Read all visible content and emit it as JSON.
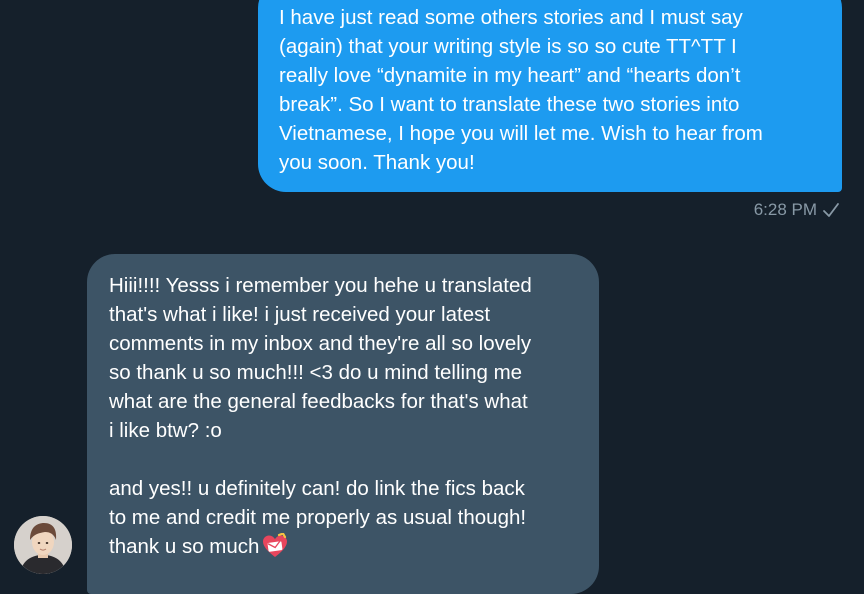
{
  "conversation": {
    "sent_message": {
      "text": "I have just read some others stories and I must say\n(again) that your writing style is so so cute TT^TT I\nreally love “dynamite in my heart” and “hearts don’t\nbreak”. So I want to translate these two stories into\nVietnamese, I hope you will let me. Wish to hear from\nyou soon. Thank you!",
      "time": "6:28 PM",
      "status_icon": "checkmark-icon"
    },
    "received_message": {
      "text": "Hiii!!!! Yesss i remember you hehe u translated\nthat's what i like! i just received your latest\ncomments in my inbox and they're all so lovely\nso thank u so much!!! <3 do u mind telling me\nwhat are the general feedbacks for that's what\ni like btw? :o\n\nand yes!! u definitely can! do link the fics back\nto me and credit me properly as usual though!\nthank u so much",
      "emoji_icon": "love-letter-icon"
    }
  },
  "colors": {
    "background": "#15202b",
    "sent_bubble": "#1d9bf0",
    "received_bubble": "#3d5466",
    "timestamp": "#8899a6"
  }
}
